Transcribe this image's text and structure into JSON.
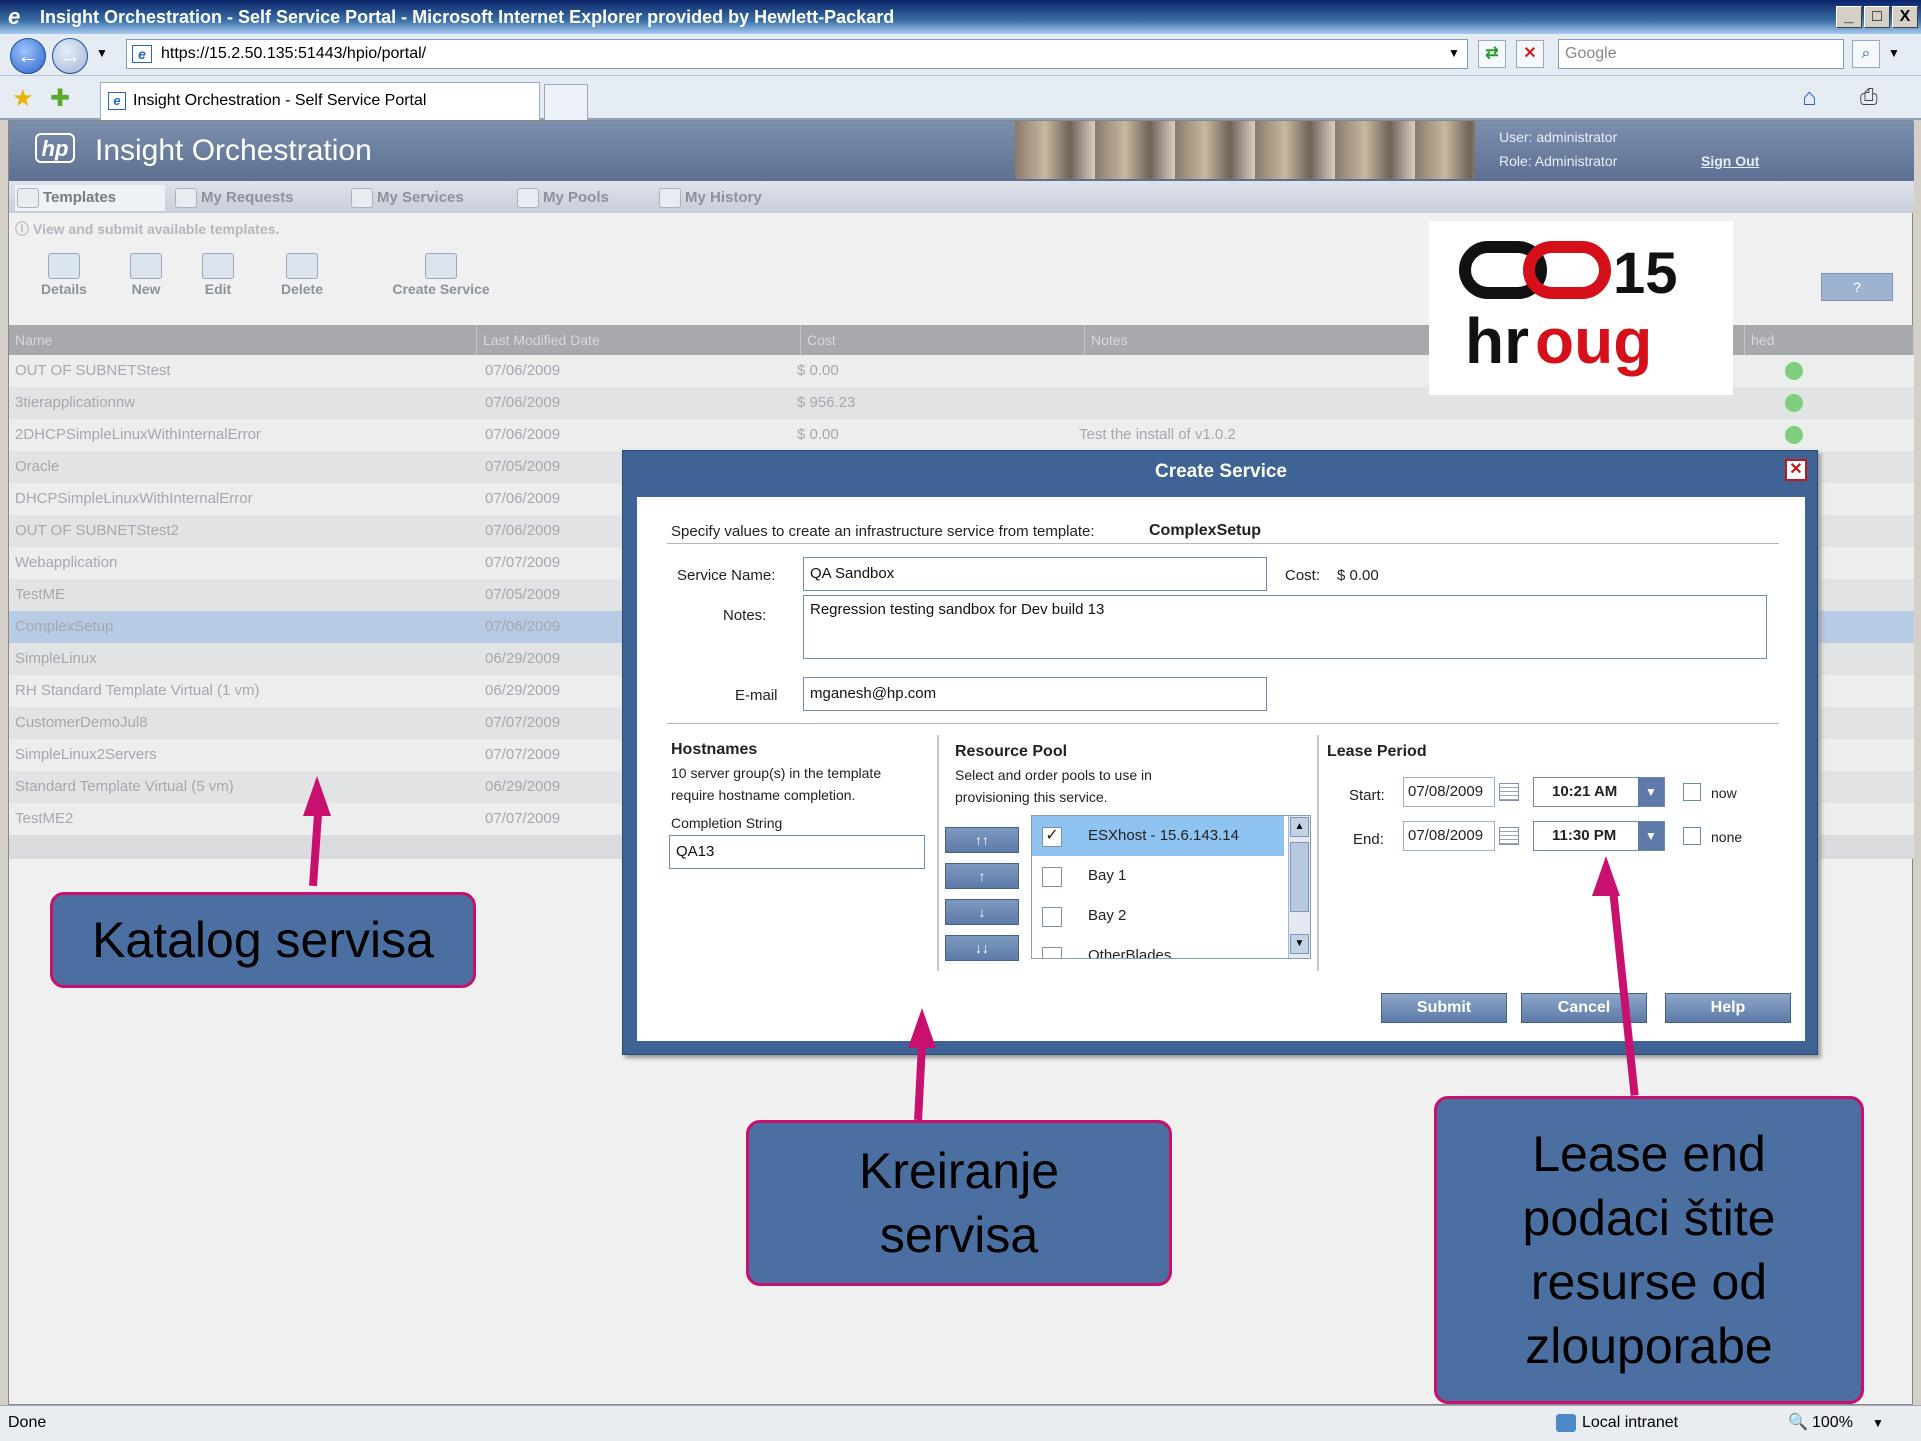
{
  "window": {
    "title": "Insight Orchestration - Self Service Portal - Microsoft Internet Explorer provided by Hewlett-Packard",
    "controls": [
      "_",
      "□",
      "X"
    ]
  },
  "browser": {
    "url": "https://15.2.50.135:51443/hpio/portal/",
    "search_placeholder": "Google",
    "tab_title": "Insight Orchestration - Self Service Portal",
    "status_left": "Done",
    "zone": "Local intranet",
    "zoom": "100%"
  },
  "portal": {
    "app_title": "Insight Orchestration",
    "logo_text": "hp",
    "user_label": "User: administrator",
    "role_label": "Role: Administrator",
    "sign_out": "Sign Out",
    "nav_tabs": [
      "Templates",
      "My Requests",
      "My Services",
      "My Pools",
      "My History"
    ],
    "info_text": "View and submit available templates.",
    "toolbar": [
      "Details",
      "New",
      "Edit",
      "Delete",
      "Create Service"
    ],
    "help_label": "?",
    "columns": [
      "Name",
      "Last Modified Date",
      "Cost",
      "Notes",
      "hed"
    ],
    "rows": [
      {
        "name": "OUT OF SUBNETStest",
        "date": "07/06/2009",
        "cost": "$ 0.00",
        "notes": "",
        "ok": true
      },
      {
        "name": "3tierapplicationnw",
        "date": "07/06/2009",
        "cost": "$ 956.23",
        "notes": "",
        "ok": true
      },
      {
        "name": "2DHCPSimpleLinuxWithInternalError",
        "date": "07/06/2009",
        "cost": "$ 0.00",
        "notes": "Test the install of v1.0.2",
        "ok": true
      },
      {
        "name": "Oracle",
        "date": "07/05/2009",
        "cost": "",
        "notes": "",
        "ok": false
      },
      {
        "name": "DHCPSimpleLinuxWithInternalError",
        "date": "07/06/2009",
        "cost": "",
        "notes": "",
        "ok": false
      },
      {
        "name": "OUT OF SUBNETStest2",
        "date": "07/06/2009",
        "cost": "",
        "notes": "",
        "ok": false
      },
      {
        "name": "Webapplication",
        "date": "07/07/2009",
        "cost": "",
        "notes": "",
        "ok": false
      },
      {
        "name": "TestME",
        "date": "07/05/2009",
        "cost": "",
        "notes": "",
        "ok": false
      },
      {
        "name": "ComplexSetup",
        "date": "07/06/2009",
        "cost": "",
        "notes": "",
        "ok": false
      },
      {
        "name": "SimpleLinux",
        "date": "06/29/2009",
        "cost": "",
        "notes": "",
        "ok": false
      },
      {
        "name": "RH Standard Template Virtual (1 vm)",
        "date": "06/29/2009",
        "cost": "",
        "notes": "",
        "ok": false
      },
      {
        "name": "CustomerDemoJul8",
        "date": "07/07/2009",
        "cost": "",
        "notes": "",
        "ok": false
      },
      {
        "name": "SimpleLinux2Servers",
        "date": "07/07/2009",
        "cost": "",
        "notes": "",
        "ok": false
      },
      {
        "name": "Standard Template Virtual (5 vm)",
        "date": "06/29/2009",
        "cost": "",
        "notes": "",
        "ok": false
      },
      {
        "name": "TestME2",
        "date": "07/07/2009",
        "cost": "",
        "notes": "",
        "ok": false
      }
    ],
    "selected_row": 8
  },
  "dialog": {
    "title": "Create Service",
    "intro": "Specify values to create an infrastructure service from template:",
    "template_name": "ComplexSetup",
    "service_name_label": "Service Name:",
    "service_name": "QA Sandbox",
    "cost_label": "Cost:",
    "cost_value": "$ 0.00",
    "notes_label": "Notes:",
    "notes_value": "Regression testing sandbox for Dev build 13",
    "email_label": "E-mail",
    "email_value": "mganesh@hp.com",
    "hostnames": {
      "heading": "Hostnames",
      "line1": "10 server group(s) in the template",
      "line2": "require hostname completion.",
      "completion_label": "Completion String",
      "completion_value": "QA13"
    },
    "resource_pool": {
      "heading": "Resource Pool",
      "line1": "Select and order pools to use in",
      "line2": "provisioning this service.",
      "order_buttons": [
        "↑↑",
        "↑",
        "↓",
        "↓↓"
      ],
      "items": [
        {
          "label": "ESXhost - 15.6.143.14",
          "checked": true
        },
        {
          "label": "Bay 1",
          "checked": false
        },
        {
          "label": "Bay 2",
          "checked": false
        },
        {
          "label": "OtherBlades",
          "checked": false
        }
      ]
    },
    "lease": {
      "heading": "Lease Period",
      "start_label": "Start:",
      "start_date": "07/08/2009",
      "start_time": "10:21 AM",
      "now_label": "now",
      "end_label": "End:",
      "end_date": "07/08/2009",
      "end_time": "11:30 PM",
      "none_label": "none"
    },
    "buttons": {
      "submit": "Submit",
      "cancel": "Cancel",
      "help": "Help"
    }
  },
  "overlay": {
    "hroug_logo": {
      "top": "OO15",
      "bottom": "hroug"
    },
    "callout_catalog": "Katalog servisa",
    "callout_create": [
      "Kreiranje",
      "servisa"
    ],
    "callout_lease": [
      "Lease end",
      "podaci štite",
      "resurse od",
      "zlouporabe"
    ]
  },
  "colors": {
    "accent": "#3e6394",
    "callout_fill": "#4a6fa0",
    "callout_border": "#c8106e",
    "selected_row": "#b8cbe4"
  }
}
